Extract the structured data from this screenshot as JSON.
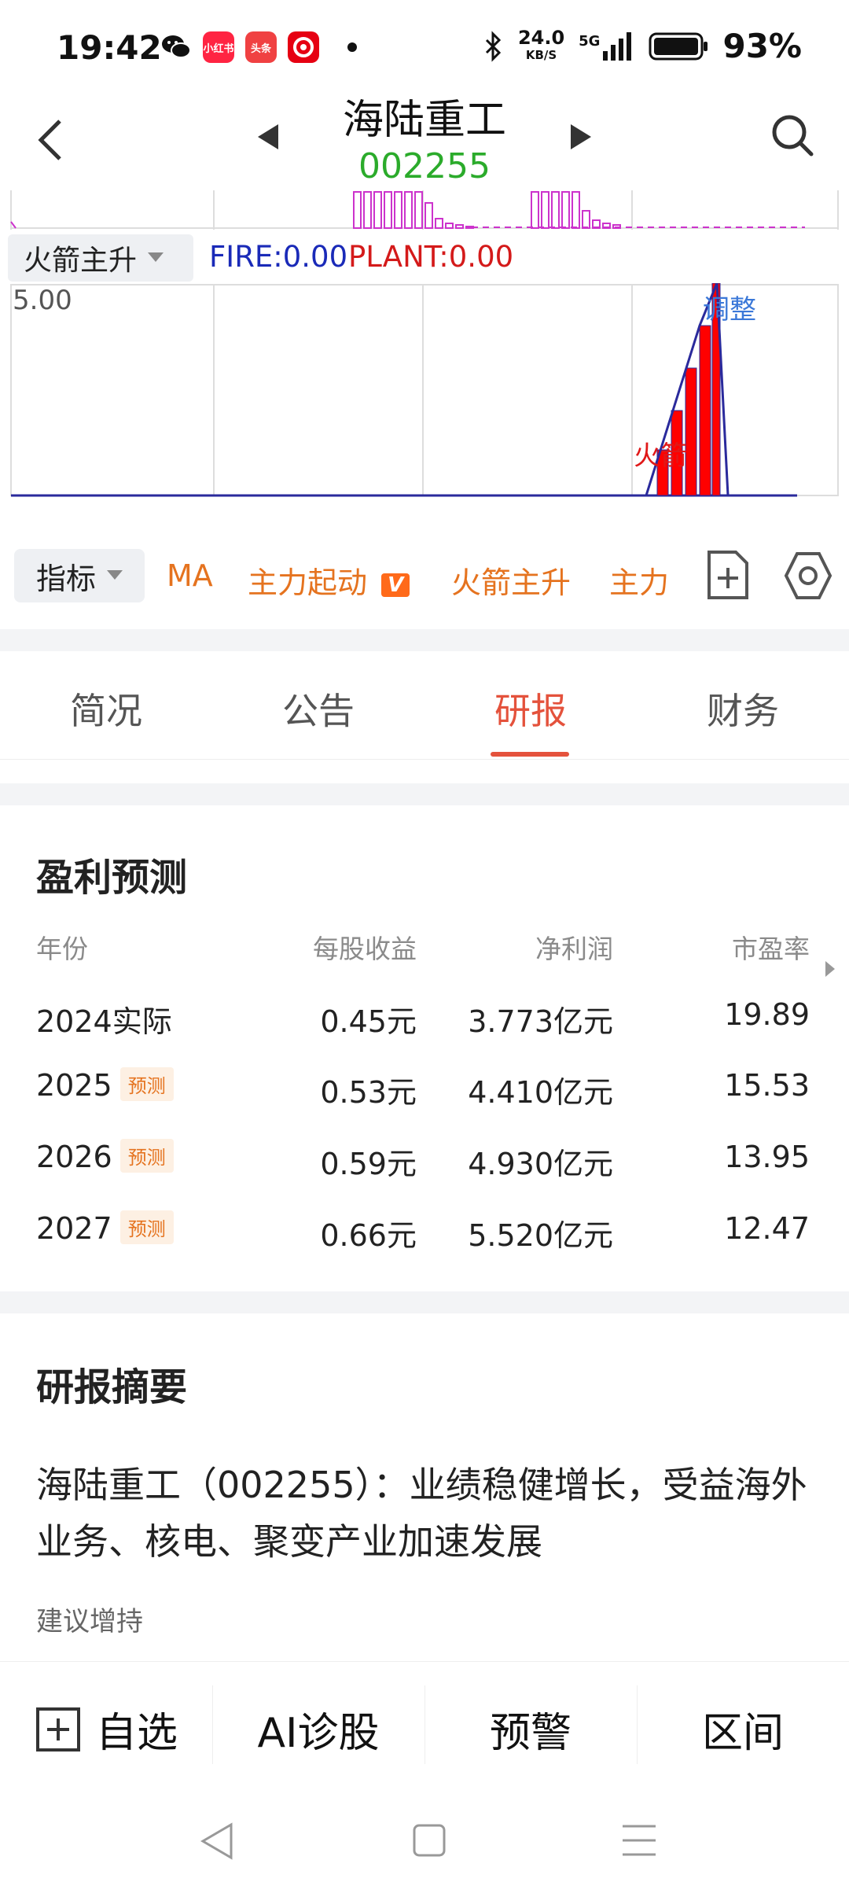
{
  "status_bar": {
    "time": "19:42",
    "app_icons": [
      "wechat-icon",
      "xiaohongshu-icon",
      "toutiao-icon",
      "netease-icon"
    ],
    "app_icon_labels": [
      "小红书",
      "头条"
    ],
    "net_speed": "24.0",
    "net_speed_unit": "KB/S",
    "network": "5G",
    "battery": "93%"
  },
  "header": {
    "title": "海陆重工",
    "code": "002255"
  },
  "chart": {
    "indicator_name": "火箭主升",
    "fire_label": "FIRE:0.00",
    "plant_label": "PLANT:0.00",
    "y_max_label": "5.00",
    "annotation_rocket": "火箭",
    "annotation_adjust": "调整",
    "colors": {
      "fire": "#1a2ab8",
      "plant": "#d41a1a",
      "bars": "#ff0000",
      "volume": "#cc33cc"
    }
  },
  "indicator_bar": {
    "button_label": "指标",
    "items": [
      "MA",
      "主力起动",
      "火箭主升",
      "主力"
    ],
    "badge_text": "V"
  },
  "tabs": {
    "items": [
      "简况",
      "公告",
      "研报",
      "财务"
    ],
    "active": "研报"
  },
  "forecast": {
    "title": "盈利预测",
    "headers": [
      "年份",
      "每股收益",
      "净利润",
      "市盈率"
    ],
    "badge_label": "预测",
    "rows": [
      {
        "year": "2024实际",
        "eps": "0.45元",
        "profit": "3.773亿元",
        "pe": "19.89"
      },
      {
        "year": "2025",
        "eps": "0.53元",
        "profit": "4.410亿元",
        "pe": "15.53"
      },
      {
        "year": "2026",
        "eps": "0.59元",
        "profit": "4.930亿元",
        "pe": "13.95"
      },
      {
        "year": "2027",
        "eps": "0.66元",
        "profit": "5.520亿元",
        "pe": "12.47"
      }
    ]
  },
  "summary": {
    "title": "研报摘要",
    "text": "海陆重工（002255）：业绩稳健增长，受益海外业务、核电、聚变产业加速发展",
    "recommendation": "建议增持"
  },
  "bottom_bar": {
    "watchlist": "自选",
    "ai": "AI诊股",
    "alert": "预警",
    "range": "区间"
  }
}
